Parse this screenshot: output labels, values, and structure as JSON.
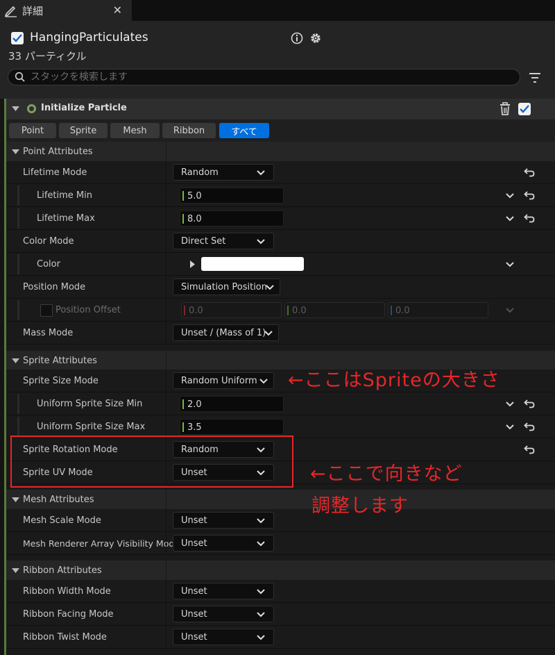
{
  "tab": {
    "label": "詳細",
    "close": "✕"
  },
  "header": {
    "title": "HangingParticulates",
    "subtitle": "33 パーティクル",
    "search_placeholder": "スタックを検索します"
  },
  "module": {
    "title": "Initialize Particle",
    "filters": [
      {
        "label": "Point",
        "active": false
      },
      {
        "label": "Sprite",
        "active": false
      },
      {
        "label": "Mesh",
        "active": false
      },
      {
        "label": "Ribbon",
        "active": false
      },
      {
        "label": "すべて",
        "active": true
      }
    ]
  },
  "sections": {
    "point": "Point Attributes",
    "sprite": "Sprite Attributes",
    "mesh": "Mesh Attributes",
    "ribbon": "Ribbon Attributes"
  },
  "rows": {
    "lifetime_mode": {
      "label": "Lifetime Mode",
      "value": "Random"
    },
    "lifetime_min": {
      "label": "Lifetime Min",
      "value": "5.0"
    },
    "lifetime_max": {
      "label": "Lifetime Max",
      "value": "8.0"
    },
    "color_mode": {
      "label": "Color Mode",
      "value": "Direct Set"
    },
    "color": {
      "label": "Color",
      "swatch": "#ffffff"
    },
    "position_mode": {
      "label": "Position Mode",
      "value": "Simulation Position"
    },
    "position_offset": {
      "label": "Position Offset",
      "x": "0.0",
      "y": "0.0",
      "z": "0.0"
    },
    "mass_mode": {
      "label": "Mass Mode",
      "value": "Unset / (Mass of 1)"
    },
    "sprite_size_mode": {
      "label": "Sprite Size Mode",
      "value": "Random Uniform"
    },
    "uniform_min": {
      "label": "Uniform Sprite Size Min",
      "value": "2.0"
    },
    "uniform_max": {
      "label": "Uniform Sprite Size Max",
      "value": "3.5"
    },
    "sprite_rotation_mode": {
      "label": "Sprite Rotation Mode",
      "value": "Random"
    },
    "sprite_uv_mode": {
      "label": "Sprite UV Mode",
      "value": "Unset"
    },
    "mesh_scale_mode": {
      "label": "Mesh Scale Mode",
      "value": "Unset"
    },
    "mesh_vis_mode": {
      "label": "Mesh Renderer Array Visibility Mod",
      "value": "Unset"
    },
    "ribbon_width_mode": {
      "label": "Ribbon Width Mode",
      "value": "Unset"
    },
    "ribbon_facing_mode": {
      "label": "Ribbon Facing Mode",
      "value": "Unset"
    },
    "ribbon_twist_mode": {
      "label": "Ribbon Twist Mode",
      "value": "Unset"
    }
  },
  "annotations": {
    "note1": "←ここはSpriteの大きさ",
    "note2a": "←ここで向きなど",
    "note2b": "調整します"
  },
  "colors": {
    "accent": "#0070e0",
    "annotation": "#e8262a",
    "module_accent": "#5c7a3a"
  }
}
